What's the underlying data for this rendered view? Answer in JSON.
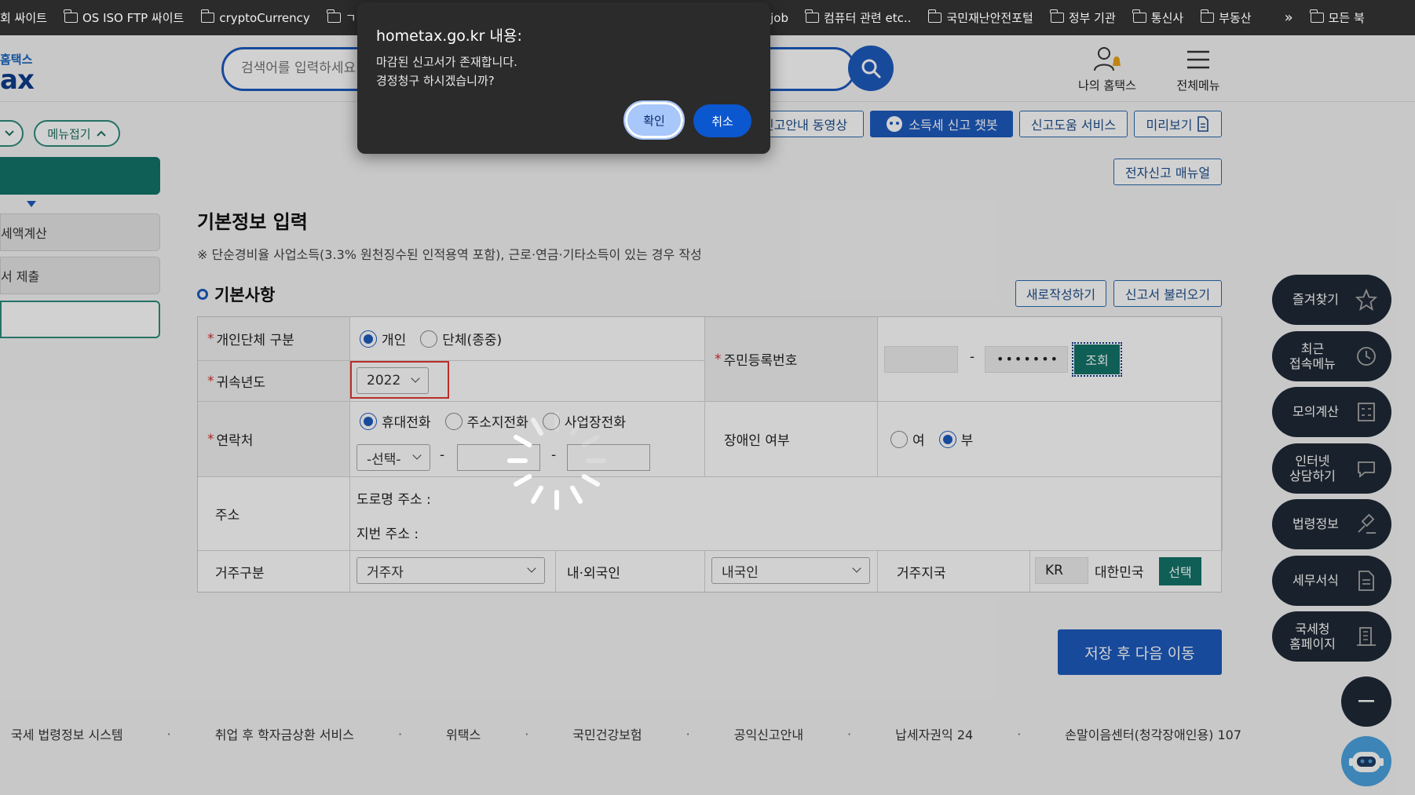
{
  "bookmarks": [
    {
      "label": "회 싸이트",
      "folder": false
    },
    {
      "label": "OS ISO FTP 싸이트",
      "folder": true
    },
    {
      "label": "cryptoCurrency",
      "folder": true
    },
    {
      "label": "ㄱ",
      "folder": true
    },
    {
      "label": "_job",
      "folder": false
    },
    {
      "label": "컴퓨터 관련 etc..",
      "folder": true
    },
    {
      "label": "국민재난안전포털",
      "folder": true
    },
    {
      "label": "정부 기관",
      "folder": true
    },
    {
      "label": "통신사",
      "folder": true
    },
    {
      "label": "부동산",
      "folder": true
    },
    {
      "label": "»",
      "folder": false
    },
    {
      "label": "모든 북",
      "folder": true
    }
  ],
  "header": {
    "logo_sub": "홈택스",
    "logo_main": "ax",
    "search_placeholder": "검색어를 입력하세요",
    "my_hometax": "나의 홈택스",
    "all_menu": "전체메뉴"
  },
  "left_panel": {
    "menu_collapse": "메뉴접기",
    "items": [
      "세액계산",
      "서 제출"
    ]
  },
  "actions": {
    "guide_video": "신고안내 동영상",
    "chatbot": "소득세 신고 챗봇",
    "help_service": "신고도움 서비스",
    "preview": "미리보기",
    "manual": "전자신고 매뉴얼",
    "new_write": "새로작성하기",
    "load_return": "신고서 불러오기",
    "save_next": "저장 후 다음 이동"
  },
  "page": {
    "title": "기본정보 입력",
    "note": "※ 단순경비율 사업소득(3.3% 원천징수된 인적용역 포함), 근로·연금·기타소득이 있는 경우 작성",
    "section": "기본사항"
  },
  "form": {
    "type_label": "개인단체 구분",
    "type_options": [
      "개인",
      "단체(종중)"
    ],
    "type_selected": "개인",
    "year_label": "귀속년도",
    "year_value": "2022",
    "rrn_label": "주민등록번호",
    "rrn_mask": "•••••••",
    "rrn_dash": "-",
    "lookup_btn": "조회",
    "contact_label": "연락처",
    "contact_options": [
      "휴대전화",
      "주소지전화",
      "사업장전화"
    ],
    "contact_selected": "휴대전화",
    "phone_select": "-선택-",
    "dash": "-",
    "disabled_label": "장애인 여부",
    "disabled_options": [
      "여",
      "부"
    ],
    "disabled_selected": "부",
    "address_label": "주소",
    "road_address": "도로명 주소 :",
    "lot_address": "지번 주소 :",
    "residence_label": "거주구분",
    "residence_value": "거주자",
    "nationality_label": "내·외국인",
    "nationality_value": "내국인",
    "country_label": "거주지국",
    "country_code": "KR",
    "country_name": "대한민국",
    "country_select_btn": "선택"
  },
  "right_menu": [
    {
      "label": "즐겨찾기",
      "icon": "star-icon"
    },
    {
      "label": "최근\n접속메뉴",
      "icon": "clock-icon"
    },
    {
      "label": "모의계산",
      "icon": "calculator-icon"
    },
    {
      "label": "인터넷\n상담하기",
      "icon": "chat-icon"
    },
    {
      "label": "법령정보",
      "icon": "gavel-icon"
    },
    {
      "label": "세무서식",
      "icon": "document-icon"
    },
    {
      "label": "국세청\n홈페이지",
      "icon": "building-icon"
    }
  ],
  "footer": [
    "국세 법령정보 시스템",
    "취업 후 학자금상환 서비스",
    "위택스",
    "국민건강보험",
    "공익신고안내",
    "납세자권익 24",
    "손말이음센터(청각장애인용) 107"
  ],
  "dialog": {
    "title": "hometax.go.kr 내용:",
    "line1": "마감된 신고서가 존재합니다.",
    "line2": "경정청구 하시겠습니까?",
    "ok": "확인",
    "cancel": "취소"
  },
  "colors": {
    "primary": "#1e5bbf",
    "teal": "#13756a",
    "dark_fab": "#1f2a36",
    "highlight_red": "#e53935"
  }
}
